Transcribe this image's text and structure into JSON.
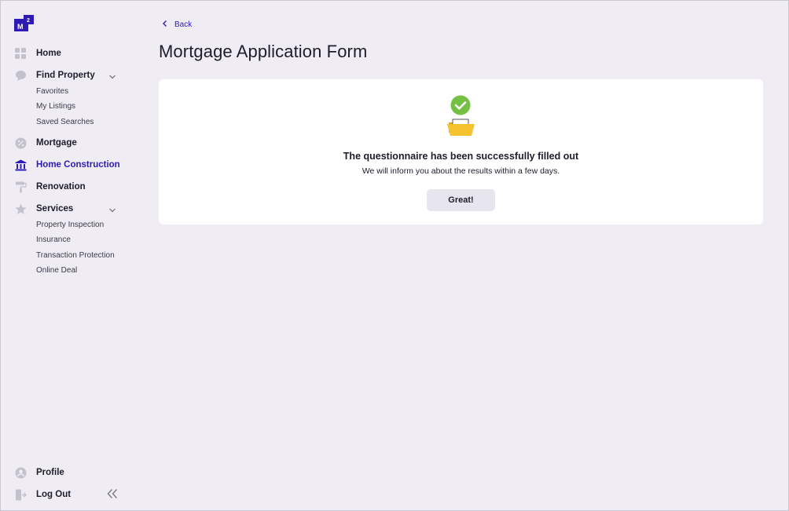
{
  "logo": {
    "text": "M",
    "superscript": "2",
    "color": "#2e1bb5"
  },
  "sidebar": {
    "items": [
      {
        "label": "Home",
        "icon": "grid-icon"
      },
      {
        "label": "Find Property",
        "icon": "chat-bubble-icon",
        "expanded": true,
        "children": [
          "Favorites",
          "My Listings",
          "Saved Searches"
        ]
      },
      {
        "label": "Mortgage",
        "icon": "percent-icon"
      },
      {
        "label": "Home Construction",
        "icon": "bank-building-icon",
        "active": true
      },
      {
        "label": "Renovation",
        "icon": "paint-roller-icon"
      },
      {
        "label": "Services",
        "icon": "star-icon",
        "expanded": true,
        "children": [
          "Property Inspection",
          "Insurance",
          "Transaction Protection",
          "Online Deal"
        ]
      }
    ],
    "footer": [
      {
        "label": "Profile",
        "icon": "user-icon"
      },
      {
        "label": "Log Out",
        "icon": "logout-icon"
      }
    ]
  },
  "header": {
    "back_label": "Back",
    "title": "Mortgage Application Form"
  },
  "card": {
    "message_title": "The questionnaire has been successfully filled out",
    "message_subtitle": "We will inform you about the results within a few days.",
    "button_label": "Great!"
  },
  "colors": {
    "accent": "#2e1bb5",
    "success": "#74c043",
    "folder": "#f5c231",
    "background": "#efedf3"
  }
}
